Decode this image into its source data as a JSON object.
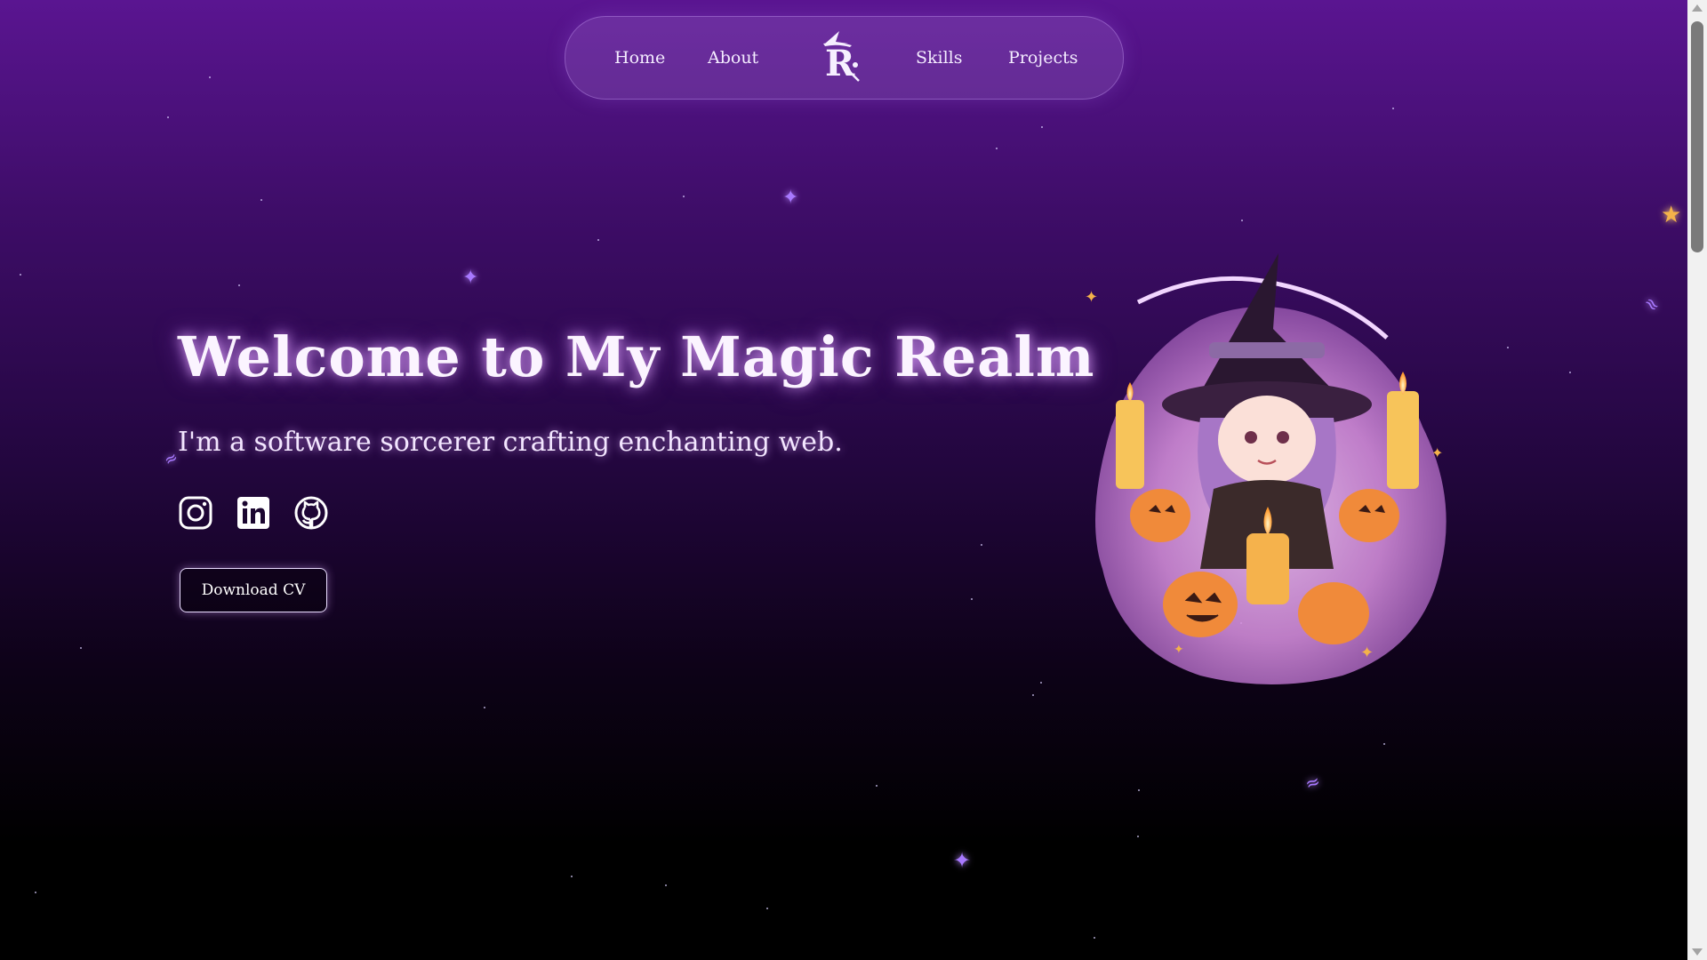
{
  "nav": {
    "links": [
      "Home",
      "About",
      "Skills",
      "Projects"
    ],
    "logo_icon": "witch-hat-r-logo-icon"
  },
  "hero": {
    "title": "Welcome to My Magic Realm",
    "subtitle": "I'm a software sorcerer crafting enchanting web.",
    "cv_button": "Download CV"
  },
  "socials": {
    "icons": [
      "instagram-icon",
      "linkedin-icon",
      "github-icon"
    ]
  },
  "illustration": {
    "icon": "witch-with-pumpkins-and-candles-illustration"
  },
  "colors": {
    "background_top": "#5a1591",
    "background_bottom": "#000000",
    "accent_glow": "#d9a8ff",
    "sparkle": "#a879ff",
    "pumpkin": "#f08a3a"
  }
}
